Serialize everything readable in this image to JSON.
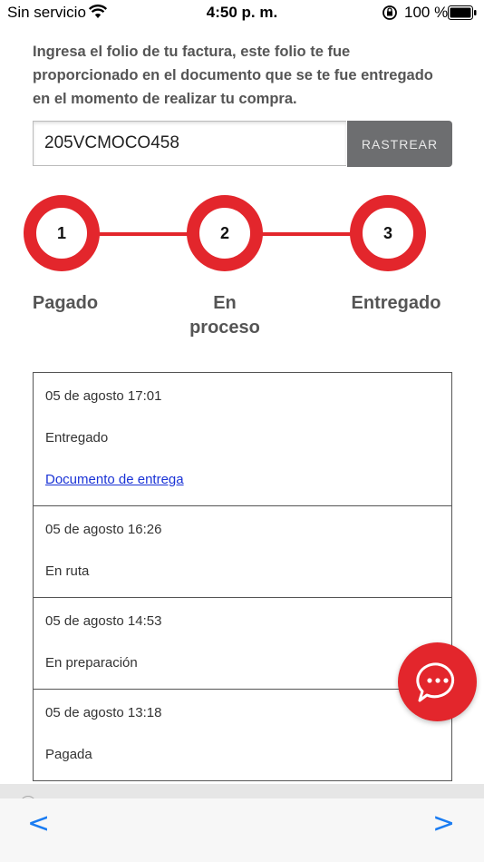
{
  "status_bar": {
    "carrier": "Sin servicio",
    "time": "4:50 p. m.",
    "battery_percent": "100 %",
    "icons": [
      "wifi-icon",
      "orientation-lock-icon",
      "battery-icon"
    ]
  },
  "instructions": "Ingresa el folio de tu factura, este folio te fue proporcionado en el documento que se te fue entregado en el momento de realizar tu compra.",
  "search": {
    "value": "205VCMOCO458",
    "button_label": "RASTREAR"
  },
  "steps": [
    {
      "number": "1",
      "label": "Pagado"
    },
    {
      "number": "2",
      "label": "En proceso"
    },
    {
      "number": "3",
      "label": "Entregado"
    }
  ],
  "history": [
    {
      "date": "05 de agosto 17:01",
      "status": "Entregado",
      "link": "Documento de entrega"
    },
    {
      "date": "05 de agosto 16:26",
      "status": "En ruta"
    },
    {
      "date": "05 de agosto 14:53",
      "status": "En preparación"
    },
    {
      "date": "05 de agosto 13:18",
      "status": "Pagada"
    }
  ],
  "toolbar": {
    "back_label": "<",
    "forward_label": ">"
  },
  "colors": {
    "accent_red": "#e3262c",
    "button_gray": "#6d6e70",
    "link_blue": "#1a33d6",
    "nav_blue": "#1a7cf2"
  }
}
